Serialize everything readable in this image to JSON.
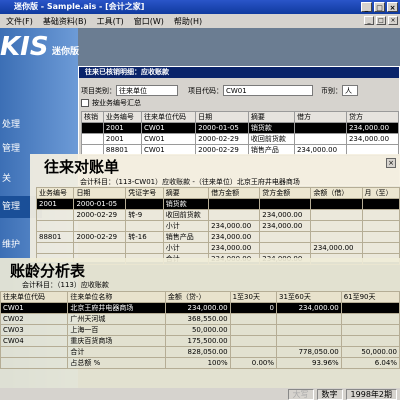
{
  "titlebar": {
    "title": "迷你版 - Sample.ais - [会计之家]",
    "winbtns": [
      "_",
      "□",
      "×"
    ]
  },
  "menubar": {
    "items": [
      "文件(F)",
      "基础资料(B)",
      "工具(T)",
      "窗口(W)",
      "帮助(H)"
    ],
    "btns": [
      "_",
      "□",
      "×"
    ]
  },
  "logo": {
    "text": "KIS",
    "mini": "迷你版"
  },
  "nav": [
    "处理",
    "管理",
    "关",
    "管理",
    "维护"
  ],
  "win1": {
    "title": "往来已核销明细：应收账款",
    "project_type_label": "项目类别：",
    "project_type_value": "往来单位",
    "project_code_label": "项目代码：",
    "project_code_value": "CW01",
    "currency_label": "币别：",
    "currency_value": "人",
    "checkbox_label": "按业务编号汇总",
    "columns": [
      "核销",
      "业务编号",
      "往来单位代码",
      "日期",
      "摘要",
      "借方",
      "贷方"
    ],
    "rows": [
      [
        "",
        "2001",
        "CW01",
        "2000-01-05",
        "销货款",
        "",
        "234,000.00"
      ],
      [
        "",
        "2001",
        "CW01",
        "2000-02-29",
        "收回前货款",
        "",
        "234,000.00"
      ],
      [
        "",
        "88801",
        "CW01",
        "2000-02-29",
        "销售产品",
        "234,000.00",
        ""
      ]
    ]
  },
  "win2": {
    "title": "往来对账单",
    "subtitle": "会计科目：（113-CW01）应收账款 -（往来单位）北京王府井电器商场",
    "close": "×",
    "columns": [
      "业务编号",
      "日期",
      "凭证字号",
      "摘要",
      "借方金额",
      "贷方金额",
      "余额（借）",
      "月（至）"
    ],
    "rows": [
      [
        "2001",
        "2000-01-05",
        "",
        "销货款",
        "",
        "",
        "",
        ""
      ],
      [
        "",
        "2000-02-29",
        "转-9",
        "收回前货款",
        "",
        "234,000.00",
        "",
        ""
      ],
      [
        "",
        "",
        "",
        "小计",
        "234,000.00",
        "234,000.00",
        "",
        ""
      ],
      [
        "88801",
        "2000-02-29",
        "转-16",
        "销售产品",
        "234,000.00",
        "",
        "",
        ""
      ],
      [
        "",
        "",
        "",
        "小计",
        "234,000.00",
        "",
        "234,000.00",
        ""
      ],
      [
        "",
        "",
        "",
        "合计",
        "234,000.00",
        "234,000.00",
        "",
        ""
      ]
    ]
  },
  "win3": {
    "title": "账龄分析表",
    "subtitle": "会计科目：（113）应收账款",
    "columns": [
      "往来单位代码",
      "往来单位名称",
      "金额（贷-）",
      "1至30天",
      "31至60天",
      "61至90天"
    ],
    "rows": [
      [
        "CW01",
        "北京王府井电器商场",
        "234,000.00",
        "0",
        "234,000.00",
        ""
      ],
      [
        "CW02",
        "广州天河城",
        "368,550.00",
        "",
        "",
        ""
      ],
      [
        "CW03",
        "上海一百",
        "50,000.00",
        "",
        "",
        ""
      ],
      [
        "CW04",
        "重庆百货商场",
        "175,500.00",
        "",
        "",
        ""
      ],
      [
        "",
        "合计",
        "828,050.00",
        "",
        "778,050.00",
        "50,000.00"
      ],
      [
        "",
        "占总额 %",
        "100%",
        "0.00%",
        "93.96%",
        "6.04%"
      ]
    ]
  },
  "statusbar": {
    "items": [
      "大写",
      "数字",
      "1998年2期"
    ]
  }
}
